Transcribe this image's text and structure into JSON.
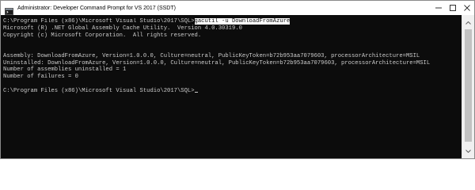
{
  "window": {
    "title": "Administrator: Developer Command Prompt for VS 2017 (SSDT)"
  },
  "console": {
    "prompt1": "C:\\Program Files (x86)\\Microsoft Visual Studio\\2017\\SQL>",
    "command": "gacutil -u DownloadFromAzure",
    "banner1": "Microsoft (R) .NET Global Assembly Cache Utility.  Version 4.0.30319.0",
    "banner2": "Copyright (c) Microsoft Corporation.  All rights reserved.",
    "assembly": "Assembly: DownloadFromAzure, Version=1.0.0.0, Culture=neutral, PublicKeyToken=b72b953aa7079603, processorArchitecture=MSIL",
    "uninstalled": "Uninstalled: DownloadFromAzure, Version=1.0.0.0, Culture=neutral, PublicKeyToken=b72b953aa7079603, processorArchitecture=MSIL",
    "count_uninstalled": "Number of assemblies uninstalled = 1",
    "count_failures": "Number of failures = 0",
    "prompt2": "C:\\Program Files (x86)\\Microsoft Visual Studio\\2017\\SQL>"
  }
}
